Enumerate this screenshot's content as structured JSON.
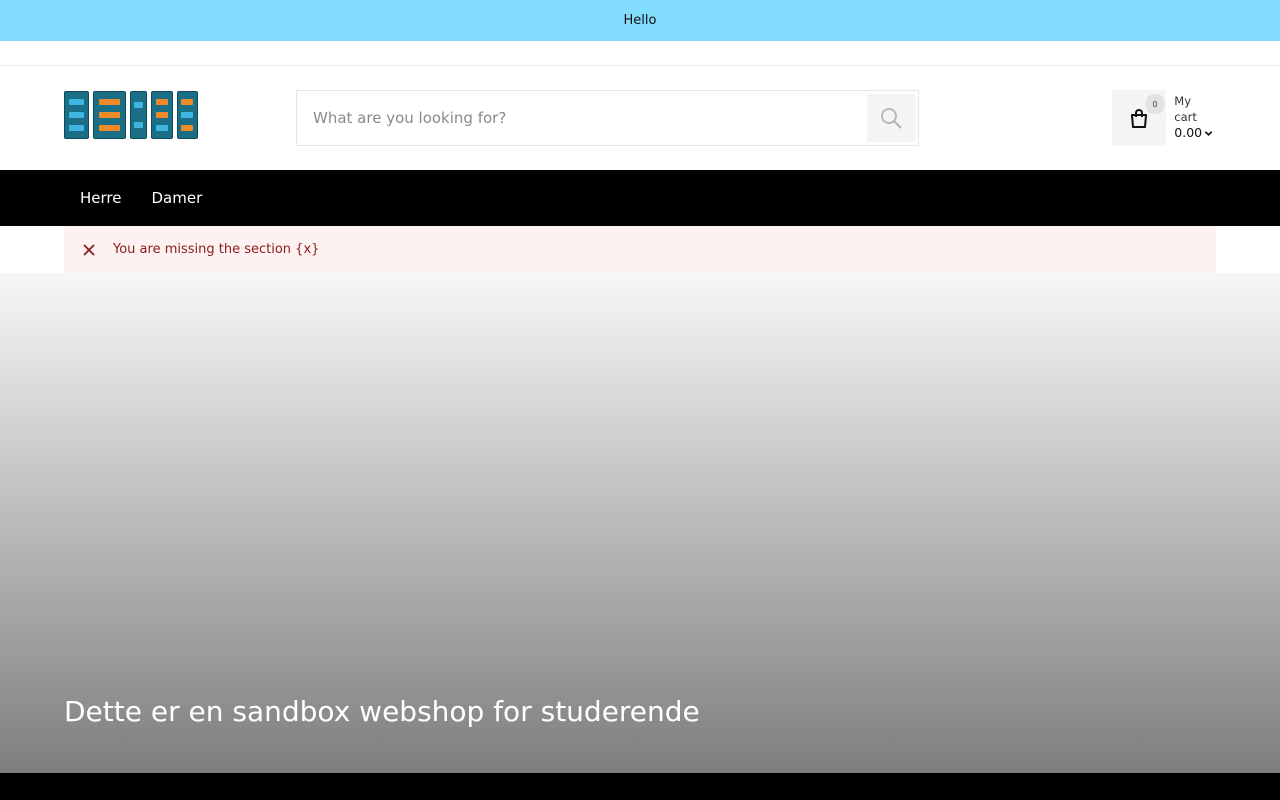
{
  "announcement": {
    "text": "Hello"
  },
  "header": {
    "search": {
      "placeholder": "What are you looking for?",
      "icon": "search-icon"
    },
    "cart": {
      "count": "0",
      "label": "My cart",
      "total": "0.00",
      "icon": "shopping-bag-icon"
    }
  },
  "nav": {
    "items": [
      {
        "label": "Herre"
      },
      {
        "label": "Damer"
      }
    ]
  },
  "notice": {
    "text": "You are missing the section {x}",
    "color": "#8a1c1c"
  },
  "hero": {
    "title": "Dette er en sandbox webshop for studerende"
  },
  "colors": {
    "announcement_bg": "#81dcfe",
    "nav_bg": "#000000",
    "notice_bg": "#fdf1f1"
  }
}
